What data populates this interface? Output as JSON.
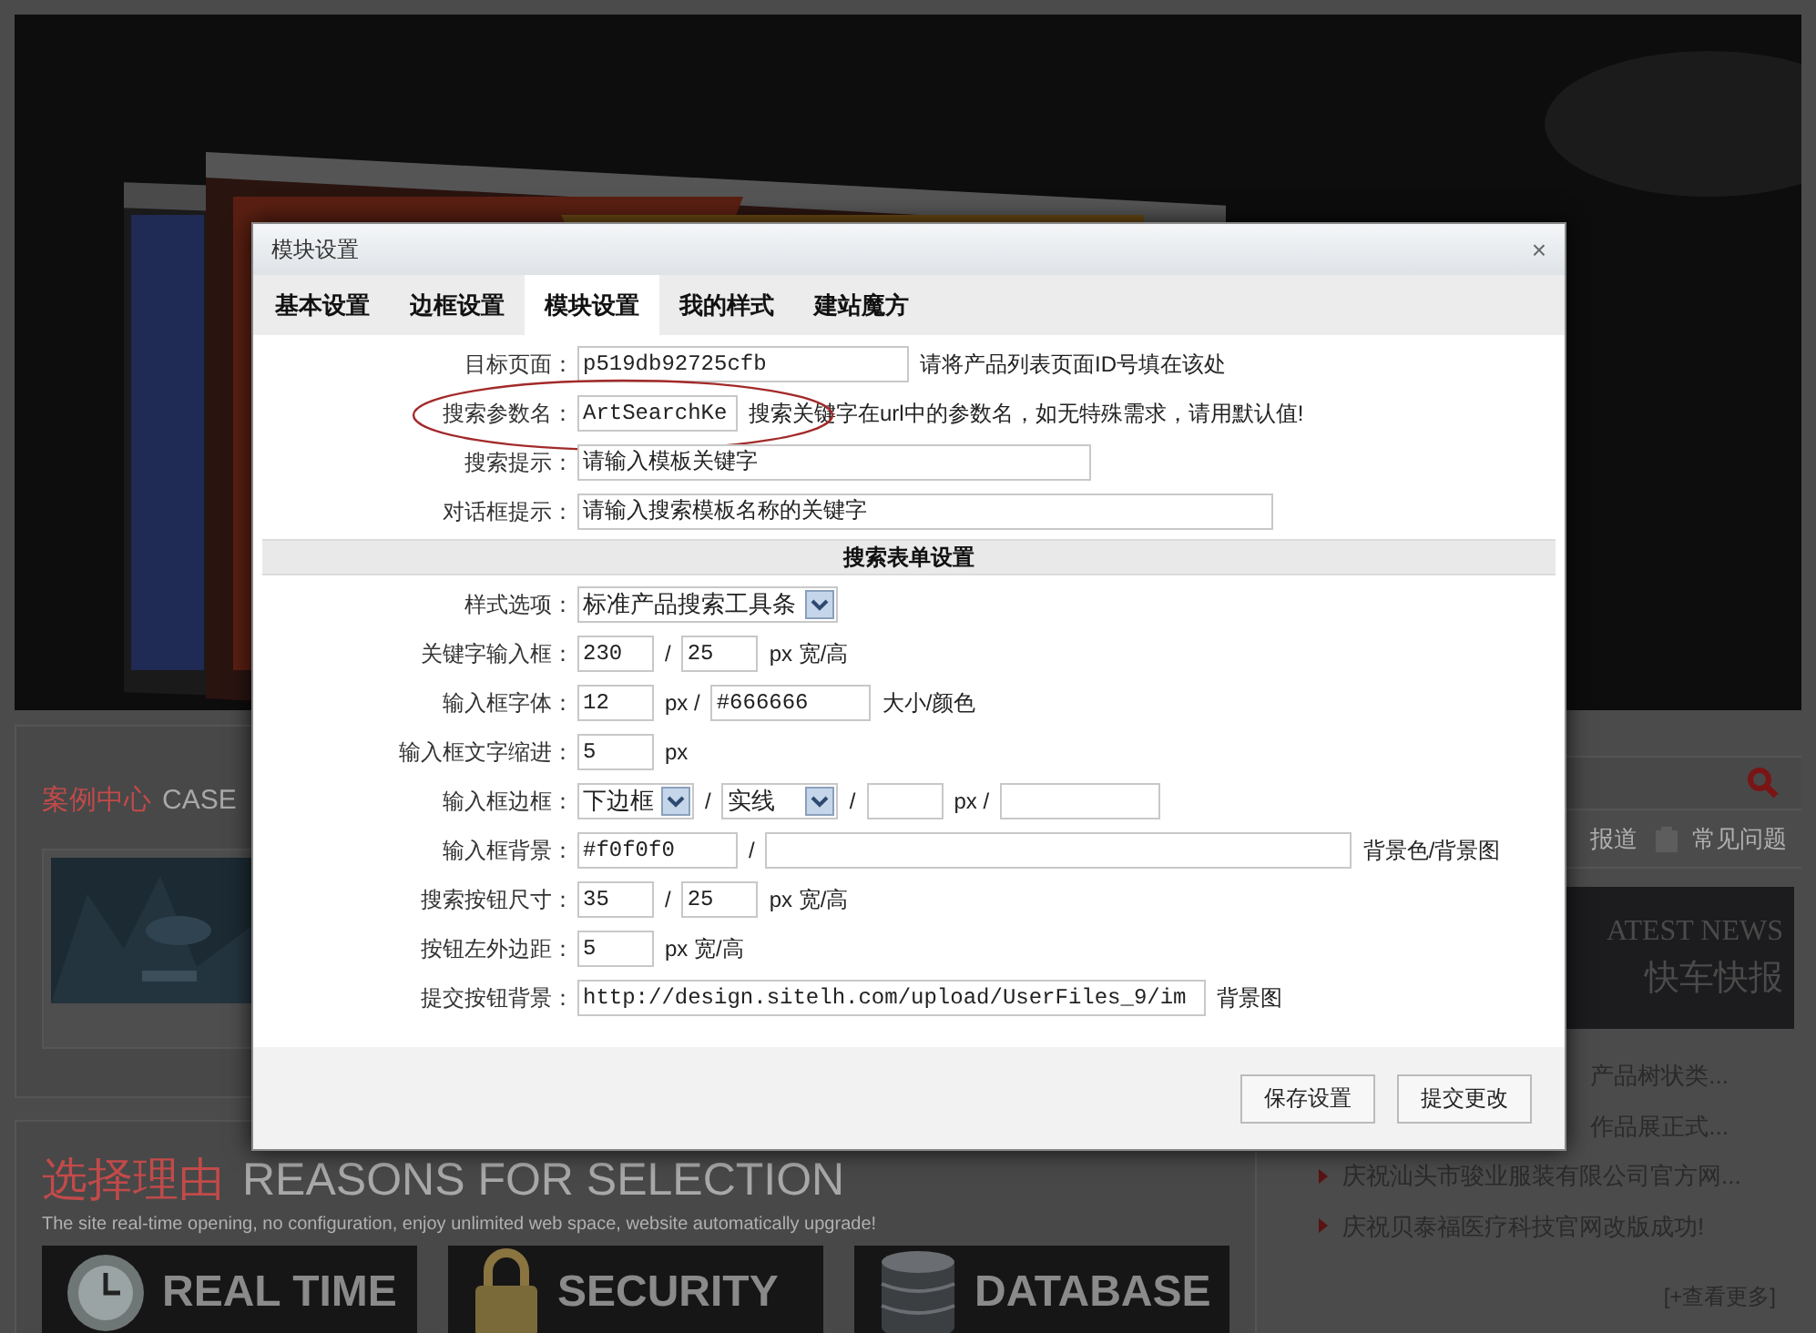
{
  "case_section": {
    "title": "案例中心",
    "subtitle": "CASE"
  },
  "reasons": {
    "title": "选择理由",
    "subtitle": "REASONS FOR SELECTION",
    "description": "The site real-time opening, no configuration, enjoy unlimited web space, website automatically upgrade!",
    "tiles": [
      {
        "label": "REAL TIME",
        "kind": "clock"
      },
      {
        "label": "SECURITY",
        "kind": "lock"
      },
      {
        "label": "DATABASE",
        "kind": "database"
      }
    ]
  },
  "side": {
    "tabs": [
      {
        "label": "报道",
        "kind": "plain"
      },
      {
        "label": "常见问题",
        "kind": "clipboard"
      }
    ],
    "news": {
      "title_en": "ATEST NEWS",
      "title": "快车快报"
    },
    "items": [
      {
        "text": "产品树状类...",
        "kind": "partial"
      },
      {
        "text": "作品展正式...",
        "kind": "partial"
      },
      {
        "text": "庆祝汕头市骏业服装有限公司官方网...",
        "kind": "full"
      },
      {
        "text": "庆祝贝泰福医疗科技官网改版成功!",
        "kind": "full"
      }
    ],
    "more": "[+查看更多]"
  },
  "dialog": {
    "title": "模块设置",
    "close": "×",
    "tabs": [
      {
        "label": "基本设置",
        "selected": false
      },
      {
        "label": "边框设置",
        "selected": false
      },
      {
        "label": "模块设置",
        "selected": true
      },
      {
        "label": "我的样式",
        "selected": false
      },
      {
        "label": "建站魔方",
        "selected": false
      }
    ],
    "rows": [
      {
        "kind": "row",
        "label": "目标页面：",
        "highlighted": false,
        "parts": [
          {
            "kind": "input",
            "value": "p519db92725cfb"
          },
          {
            "kind": "text",
            "text": "请将产品列表页面ID号填在该处"
          }
        ]
      },
      {
        "kind": "row",
        "label": "搜索参数名：",
        "highlighted": true,
        "parts": [
          {
            "kind": "input",
            "value": "ArtSearchKe"
          },
          {
            "kind": "text",
            "text": "搜索关键字在url中的参数名，如无特殊需求，请用默认值!"
          }
        ]
      },
      {
        "kind": "row",
        "label": "搜索提示：",
        "highlighted": false,
        "parts": [
          {
            "kind": "input",
            "value": "请输入模板关键字"
          }
        ]
      },
      {
        "kind": "row",
        "label": "对话框提示：",
        "highlighted": false,
        "parts": [
          {
            "kind": "input",
            "value": "请输入搜索模板名称的关键字"
          }
        ]
      },
      {
        "kind": "section",
        "label": "搜索表单设置"
      },
      {
        "kind": "row",
        "label": "样式选项：",
        "highlighted": false,
        "parts": [
          {
            "kind": "select",
            "value": "标准产品搜索工具条"
          }
        ]
      },
      {
        "kind": "row",
        "label": "关键字输入框：",
        "highlighted": false,
        "parts": [
          {
            "kind": "input",
            "value": "230"
          },
          {
            "kind": "text",
            "text": "/"
          },
          {
            "kind": "input",
            "value": "25"
          },
          {
            "kind": "text",
            "text": "px 宽/高"
          }
        ]
      },
      {
        "kind": "row",
        "label": "输入框字体：",
        "highlighted": false,
        "parts": [
          {
            "kind": "input",
            "value": "12"
          },
          {
            "kind": "text",
            "text": "px /"
          },
          {
            "kind": "input",
            "value": "#666666"
          },
          {
            "kind": "text",
            "text": "大小/颜色"
          }
        ]
      },
      {
        "kind": "row",
        "label": "输入框文字缩进：",
        "highlighted": false,
        "parts": [
          {
            "kind": "input",
            "value": "5"
          },
          {
            "kind": "text",
            "text": "px"
          }
        ]
      },
      {
        "kind": "row",
        "label": "输入框边框：",
        "highlighted": false,
        "parts": [
          {
            "kind": "select",
            "value": "下边框"
          },
          {
            "kind": "text",
            "text": "/"
          },
          {
            "kind": "select",
            "value": "实线"
          },
          {
            "kind": "text",
            "text": "/"
          },
          {
            "kind": "input"
          },
          {
            "kind": "text",
            "text": "px /"
          },
          {
            "kind": "input"
          }
        ]
      },
      {
        "kind": "row",
        "label": "输入框背景：",
        "highlighted": false,
        "parts": [
          {
            "kind": "input",
            "value": "#f0f0f0"
          },
          {
            "kind": "text",
            "text": "/"
          },
          {
            "kind": "input"
          },
          {
            "kind": "text",
            "text": "背景色/背景图"
          }
        ]
      },
      {
        "kind": "row",
        "label": "搜索按钮尺寸：",
        "highlighted": false,
        "parts": [
          {
            "kind": "input",
            "value": "35"
          },
          {
            "kind": "text",
            "text": "/"
          },
          {
            "kind": "input",
            "value": "25"
          },
          {
            "kind": "text",
            "text": "px 宽/高"
          }
        ]
      },
      {
        "kind": "row",
        "label": "按钮左外边距：",
        "highlighted": false,
        "parts": [
          {
            "kind": "input",
            "value": "5"
          },
          {
            "kind": "text",
            "text": "px 宽/高"
          }
        ]
      },
      {
        "kind": "row",
        "label": "提交按钮背景：",
        "highlighted": false,
        "parts": [
          {
            "kind": "input",
            "value": "http://design.sitelh.com/upload/UserFiles_9/im"
          },
          {
            "kind": "text",
            "text": "背景图"
          }
        ]
      }
    ],
    "buttons": [
      "保存设置",
      "提交更改"
    ]
  }
}
